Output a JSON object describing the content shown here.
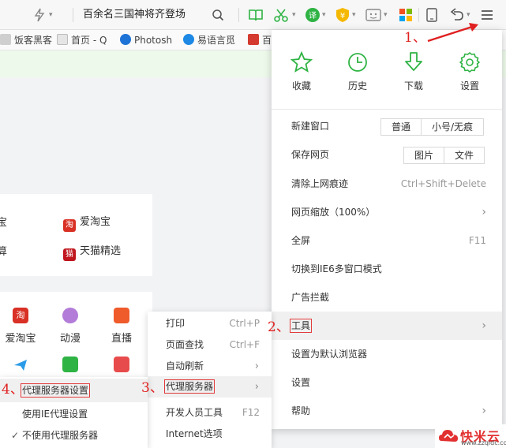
{
  "toolbar": {
    "address_text": "百余名三国神将齐登场"
  },
  "bookmarks": [
    {
      "label": "饭客黑客"
    },
    {
      "label": "首页 - Q"
    },
    {
      "label": "Photosh"
    },
    {
      "label": "易语言觅"
    },
    {
      "label": "百"
    }
  ],
  "content": {
    "links": [
      {
        "label": "爱淘宝",
        "badge": "淘"
      },
      {
        "label": "天猫精选",
        "badge": "猫"
      }
    ],
    "left_partial": [
      "宝",
      "算"
    ],
    "apps": [
      {
        "label": "爱淘宝",
        "badge": "淘"
      },
      {
        "label": "动漫"
      },
      {
        "label": "直播"
      }
    ]
  },
  "main_menu": {
    "quick": [
      {
        "label": "收藏",
        "icon": "star-icon"
      },
      {
        "label": "历史",
        "icon": "clock-icon"
      },
      {
        "label": "下载",
        "icon": "download-icon"
      },
      {
        "label": "设置",
        "icon": "gear-icon"
      }
    ],
    "new_window": {
      "label": "新建窗口",
      "options": [
        "普通",
        "小号/无痕"
      ]
    },
    "save_page": {
      "label": "保存网页",
      "options": [
        "图片",
        "文件"
      ]
    },
    "clear_traces": {
      "label": "清除上网痕迹",
      "shortcut": "Ctrl+Shift+Delete"
    },
    "zoom": {
      "label": "网页缩放（100%）"
    },
    "fullscreen": {
      "label": "全屏",
      "shortcut": "F11"
    },
    "ie6_mode": {
      "label": "切换到IE6多窗口模式"
    },
    "ad_block": {
      "label": "广告拦截"
    },
    "tools": {
      "label": "工具"
    },
    "default_browser": {
      "label": "设置为默认浏览器"
    },
    "settings": {
      "label": "设置"
    },
    "help": {
      "label": "帮助"
    }
  },
  "tools_submenu": {
    "print": {
      "label": "打印",
      "shortcut": "Ctrl+P"
    },
    "find": {
      "label": "页面查找",
      "shortcut": "Ctrl+F"
    },
    "auto_refresh": {
      "label": "自动刷新"
    },
    "proxy": {
      "label": "代理服务器"
    },
    "devtools": {
      "label": "开发人员工具",
      "shortcut": "F12"
    },
    "internet_options": {
      "label": "Internet选项"
    }
  },
  "proxy_submenu": {
    "proxy_settings": {
      "label": "代理服务器设置"
    },
    "use_ie_proxy": {
      "label": "使用IE代理设置"
    },
    "no_proxy": {
      "label": "不使用代理服务器",
      "check": "✓"
    }
  },
  "annotations": {
    "step1": "1、",
    "step2": "2、",
    "step3": "3、",
    "step4": "4、"
  },
  "watermark": {
    "text": "快米云",
    "url": "www.zzqidc.com"
  },
  "colors": {
    "accent_green": "#2fb344",
    "annotation_red": "#e02020"
  }
}
